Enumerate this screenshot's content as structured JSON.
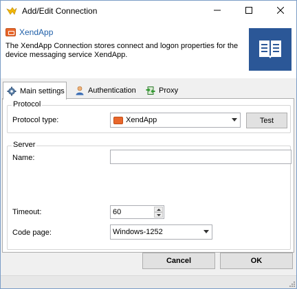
{
  "window": {
    "title": "Add/Edit Connection",
    "controls": {
      "minimize_icon": "minimize-icon",
      "maximize_icon": "maximize-icon",
      "close_icon": "close-icon"
    }
  },
  "header": {
    "name": "XendApp",
    "description": "The XendApp Connection stores connect and logon properties for the device messaging service XendApp.",
    "tile_icon": "book-icon",
    "tile_color": "#2b5797"
  },
  "tabs": [
    {
      "label": "Main settings",
      "icon": "gear-icon",
      "active": true
    },
    {
      "label": "Authentication",
      "icon": "user-icon",
      "active": false
    },
    {
      "label": "Proxy",
      "icon": "proxy-icon",
      "active": false
    }
  ],
  "protocol": {
    "group_label": "Protocol",
    "type_label": "Protocol type:",
    "type_value": "XendApp",
    "test_button": "Test"
  },
  "server": {
    "group_label": "Server",
    "name_label": "Name:",
    "name_value": "",
    "timeout_label": "Timeout:",
    "timeout_value": "60",
    "codepage_label": "Code page:",
    "codepage_value": "Windows-1252"
  },
  "footer": {
    "cancel_button": "Cancel",
    "ok_button": "OK"
  },
  "colors": {
    "accent": "#1f5fa8",
    "connection_icon": "#e8672c"
  }
}
